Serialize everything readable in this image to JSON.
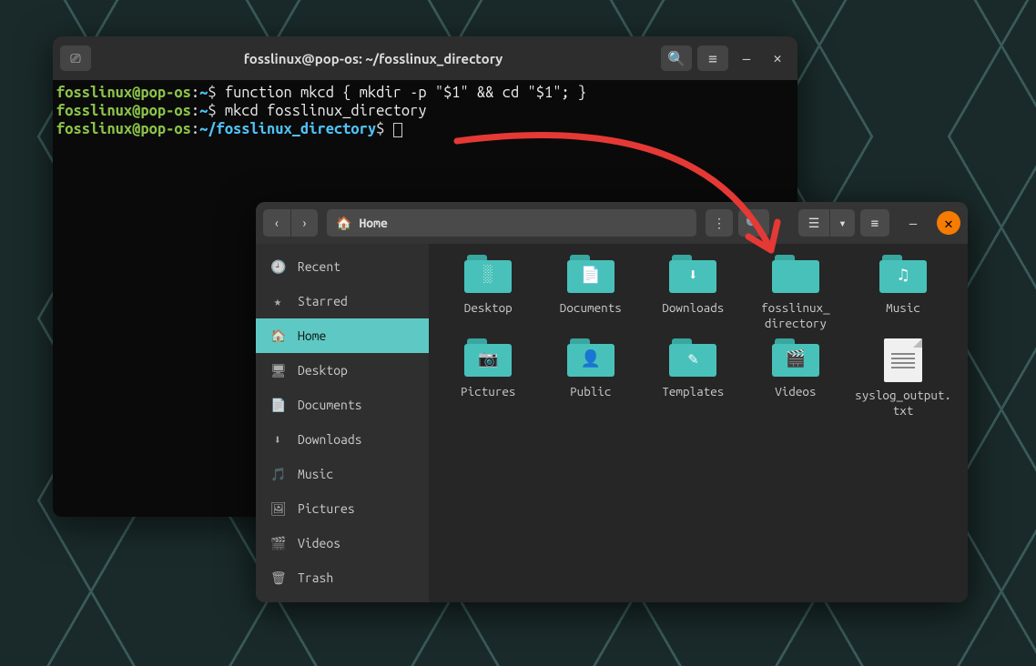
{
  "terminal": {
    "title": "fosslinux@pop-os: ~/fosslinux_directory",
    "lines": [
      {
        "user": "fosslinux@pop-os",
        "colon": ":",
        "path": "~",
        "dollar": "$ ",
        "cmd": "function mkcd { mkdir -p \"$1\" && cd \"$1\"; }"
      },
      {
        "user": "fosslinux@pop-os",
        "colon": ":",
        "path": "~",
        "dollar": "$ ",
        "cmd": "mkcd fosslinux_directory"
      },
      {
        "user": "fosslinux@pop-os",
        "colon": ":",
        "path": "~/fosslinux_directory",
        "dollar": "$ ",
        "cmd": ""
      }
    ],
    "buttons": {
      "search": "🔍",
      "menu": "≡",
      "min": "—",
      "close": "✕",
      "sys": "⎚"
    }
  },
  "files": {
    "location_label": "Home",
    "sidebar": [
      {
        "icon": "🕘",
        "label": "Recent"
      },
      {
        "icon": "★",
        "label": "Starred"
      },
      {
        "icon": "🏠",
        "label": "Home",
        "active": true
      },
      {
        "icon": "🖥",
        "label": "Desktop"
      },
      {
        "icon": "📄",
        "label": "Documents"
      },
      {
        "icon": "⬇",
        "label": "Downloads"
      },
      {
        "icon": "🎵",
        "label": "Music"
      },
      {
        "icon": "🖼",
        "label": "Pictures"
      },
      {
        "icon": "🎬",
        "label": "Videos"
      },
      {
        "icon": "🗑",
        "label": "Trash"
      }
    ],
    "items": [
      {
        "type": "folder",
        "glyph": "░",
        "label": "Desktop"
      },
      {
        "type": "folder",
        "glyph": "📄",
        "label": "Documents"
      },
      {
        "type": "folder",
        "glyph": "⬇",
        "label": "Downloads"
      },
      {
        "type": "folder",
        "glyph": "",
        "label": "fosslinux_\ndirectory"
      },
      {
        "type": "folder",
        "glyph": "♫",
        "label": "Music"
      },
      {
        "type": "folder",
        "glyph": "📷",
        "label": "Pictures"
      },
      {
        "type": "folder",
        "glyph": "👤",
        "label": "Public"
      },
      {
        "type": "folder",
        "glyph": "✎",
        "label": "Templates"
      },
      {
        "type": "folder",
        "glyph": "🎬",
        "label": "Videos"
      },
      {
        "type": "file",
        "glyph": "",
        "label": "syslog_output.\ntxt"
      }
    ],
    "buttons": {
      "back": "‹",
      "fwd": "›",
      "more": "⋮",
      "search": "🔍",
      "view": "☰",
      "drop": "▾",
      "menu": "≡",
      "min": "—",
      "close": "✕",
      "home": "🏠"
    }
  },
  "colors": {
    "accent": "#48c1ba",
    "arrow": "#e53935"
  }
}
